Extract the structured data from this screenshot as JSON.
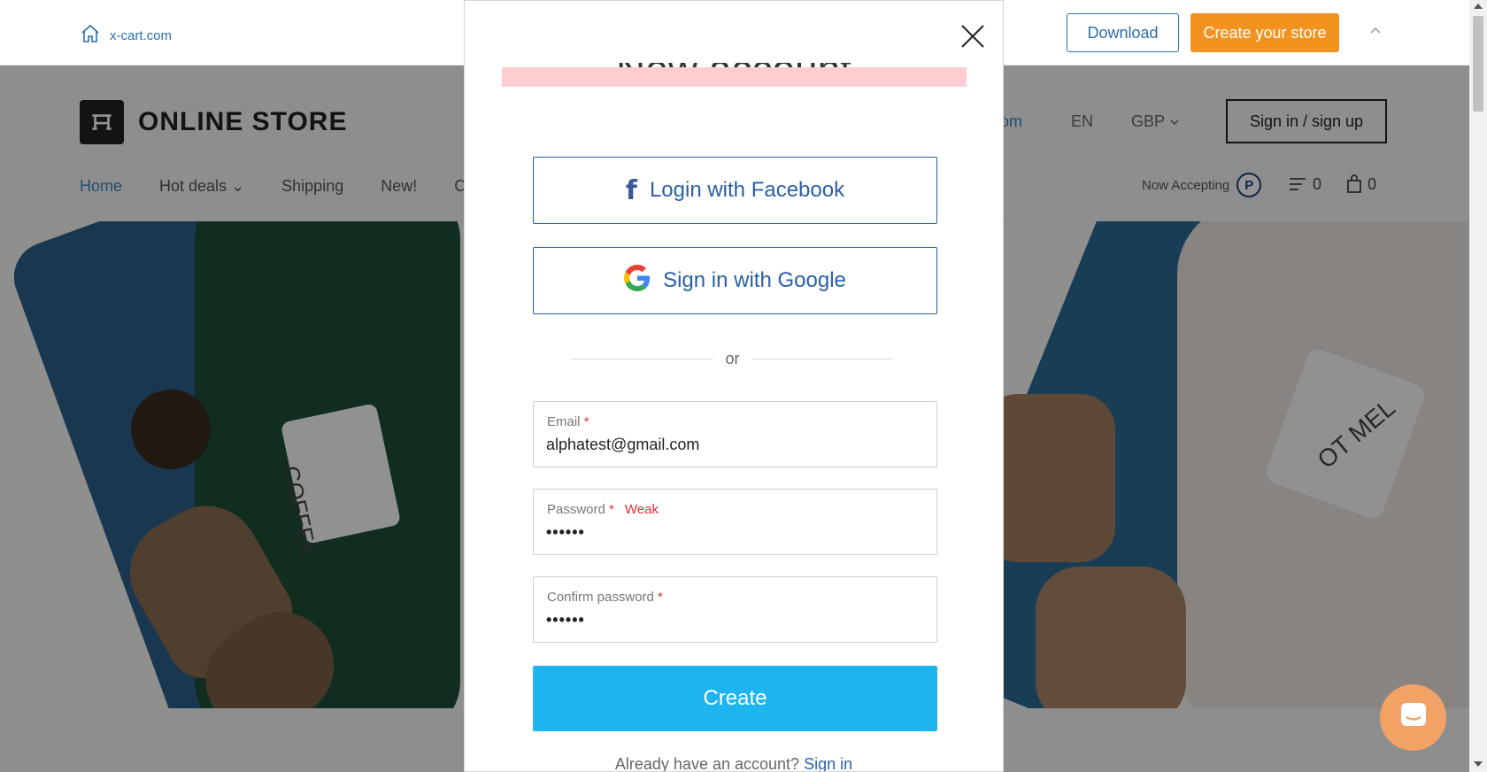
{
  "topbar": {
    "home_link": "x-cart.com",
    "download_label": "Download",
    "create_store_label": "Create your store"
  },
  "store": {
    "logo_text": "ONLINE STORE",
    "location_partial": "gdom",
    "language": "EN",
    "currency": "GBP",
    "signin_label": "Sign in / sign up",
    "nav": [
      {
        "label": "Home",
        "active": true
      },
      {
        "label": "Hot deals",
        "active": false
      },
      {
        "label": "Shipping",
        "active": false
      },
      {
        "label": "New!",
        "active": false
      },
      {
        "label": "C",
        "active": false
      }
    ],
    "now_accepting": "Now Accepting",
    "paypal_glyph": "P",
    "compare_count": "0",
    "cart_count": "0",
    "hero_mug_left": "COFFEE",
    "hero_mug_right": "OT MEL"
  },
  "modal": {
    "title": "New account",
    "facebook_label": "Login with Facebook",
    "google_label": "Sign in with Google",
    "divider": "or",
    "email": {
      "label": "Email",
      "required_mark": "*",
      "value": "alphatest@gmail.com"
    },
    "password": {
      "label": "Password",
      "required_mark": "*",
      "strength": "Weak",
      "masked_value": "••••••"
    },
    "confirm_password": {
      "label": "Confirm password",
      "required_mark": "*",
      "masked_value": "••••••"
    },
    "create_label": "Create",
    "already_text": "Already have an account?",
    "signin_link": "Sign in"
  },
  "colors": {
    "accent_blue": "#1eb4f0",
    "link_blue": "#2a5fa6",
    "orange": "#f2921f",
    "error_red": "#e0303a",
    "alert_pink": "#ffcccf"
  },
  "icons": [
    "home-icon",
    "chevron-up-icon",
    "close-icon",
    "facebook-icon",
    "google-icon",
    "paypal-icon",
    "compare-icon",
    "bag-icon",
    "chat-icon"
  ]
}
